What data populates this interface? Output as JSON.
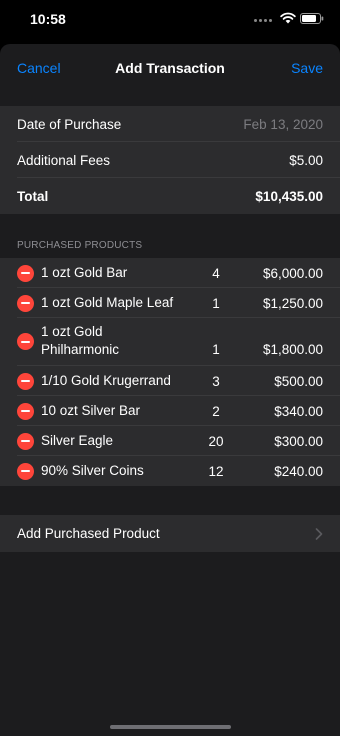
{
  "status_bar": {
    "time": "10:58"
  },
  "nav": {
    "cancel": "Cancel",
    "title": "Add Transaction",
    "save": "Save"
  },
  "summary": {
    "date_label": "Date of Purchase",
    "date_placeholder": "Feb 13, 2020",
    "fees_label": "Additional Fees",
    "fees_value": "$5.00",
    "total_label": "Total",
    "total_value": "$10,435.00"
  },
  "products_section": {
    "header": "PURCHASED PRODUCTS",
    "items": [
      {
        "name": "1 ozt Gold Bar",
        "qty": "4",
        "price": "$6,000.00"
      },
      {
        "name": "1 ozt Gold Maple Leaf",
        "qty": "1",
        "price": "$1,250.00"
      },
      {
        "name": "1 ozt Gold Philharmonic",
        "qty": "1",
        "price": "$1,800.00"
      },
      {
        "name": "1/10 Gold Krugerrand",
        "qty": "3",
        "price": "$500.00"
      },
      {
        "name": "10 ozt Silver Bar",
        "qty": "2",
        "price": "$340.00"
      },
      {
        "name": "Silver Eagle",
        "qty": "20",
        "price": "$300.00"
      },
      {
        "name": "90% Silver Coins",
        "qty": "12",
        "price": "$240.00"
      }
    ]
  },
  "add_product": {
    "label": "Add Purchased Product"
  },
  "colors": {
    "accent": "#0a84ff",
    "delete": "#ff453a",
    "background": "#1c1c1e",
    "cell": "#2c2c2e"
  }
}
